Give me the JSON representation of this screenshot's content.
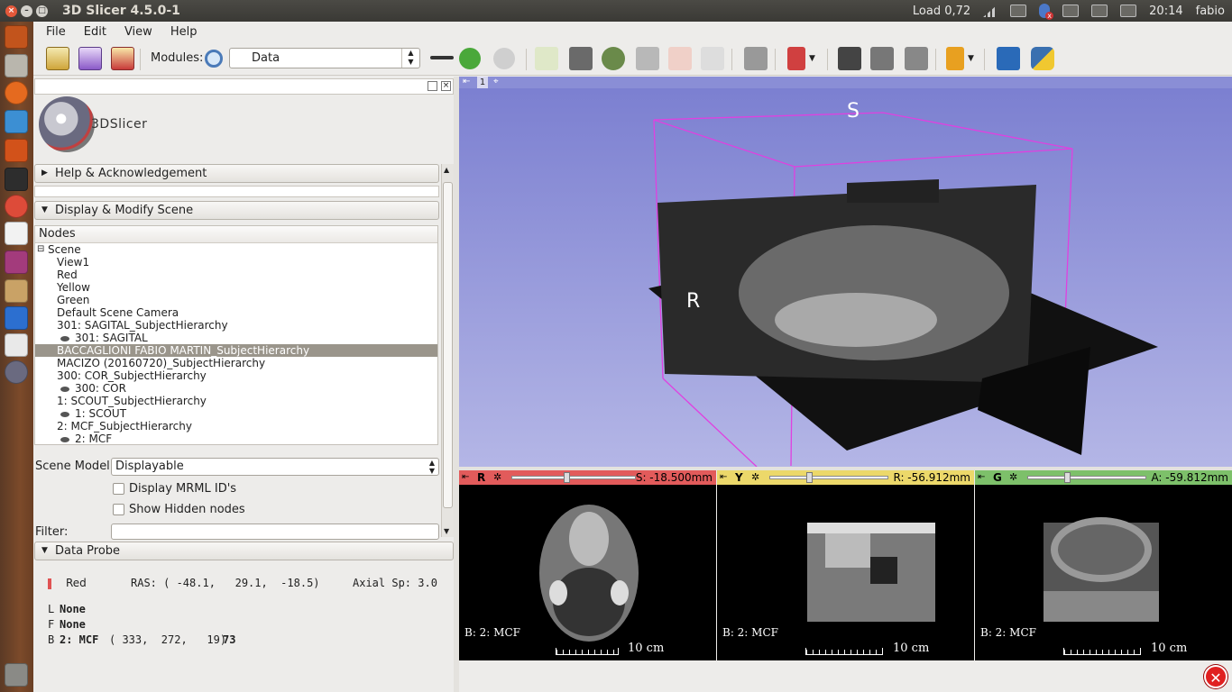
{
  "window": {
    "title": "3D Slicer 4.5.0-1"
  },
  "tray": {
    "load": "Load 0,72",
    "time": "20:14",
    "user": "fabio"
  },
  "menu": {
    "file": "File",
    "edit": "Edit",
    "view": "View",
    "help": "Help"
  },
  "toolbar": {
    "modules_label": "Modules:",
    "module_selected": "Data",
    "icons": [
      "data-icon",
      "dcm-icon",
      "save-icon",
      "search-icon",
      "layout-icon",
      "back-icon",
      "forward-icon"
    ]
  },
  "panel": {
    "logo_text": "3DSlicer",
    "help_section": "Help & Acknowledgement",
    "scene_section": "Display & Modify Scene",
    "nodes_header": "Nodes",
    "tree": [
      {
        "label": "Scene",
        "indent": 0,
        "eye": false
      },
      {
        "label": "View1",
        "indent": 1,
        "eye": false
      },
      {
        "label": "Red",
        "indent": 1,
        "eye": false
      },
      {
        "label": "Yellow",
        "indent": 1,
        "eye": false
      },
      {
        "label": "Green",
        "indent": 1,
        "eye": false
      },
      {
        "label": "Default Scene Camera",
        "indent": 1,
        "eye": false
      },
      {
        "label": "301: SAGITAL_SubjectHierarchy",
        "indent": 1,
        "eye": false
      },
      {
        "label": "301: SAGITAL",
        "indent": 2,
        "eye": true
      },
      {
        "label": "BACCAGLIONI FABIO MARTIN_SubjectHierarchy",
        "indent": 1,
        "eye": false,
        "selected": true
      },
      {
        "label": "MACIZO (20160720)_SubjectHierarchy",
        "indent": 1,
        "eye": false
      },
      {
        "label": "300: COR_SubjectHierarchy",
        "indent": 1,
        "eye": false
      },
      {
        "label": "300: COR",
        "indent": 2,
        "eye": true
      },
      {
        "label": "1: SCOUT_SubjectHierarchy",
        "indent": 1,
        "eye": false
      },
      {
        "label": "1: SCOUT",
        "indent": 2,
        "eye": true
      },
      {
        "label": "2: MCF_SubjectHierarchy",
        "indent": 1,
        "eye": false
      },
      {
        "label": "2: MCF",
        "indent": 2,
        "eye": true
      }
    ],
    "scene_model_label": "Scene Model:",
    "scene_model_value": "Displayable",
    "mrml_ids_label": "Display MRML ID's",
    "hidden_nodes_label": "Show Hidden nodes",
    "filter_label": "Filter:",
    "probe_section": "Data Probe",
    "probe": {
      "view": "Red",
      "ras": "RAS: ( -48.1,   29.1,  -18.5)",
      "spacing": "Axial Sp: 3.0",
      "l_prefix": "L",
      "l_value": "None",
      "f_prefix": "F",
      "f_value": "None",
      "b_prefix": "B",
      "b_name": "2: MCF",
      "b_ijk": "( 333,  272,   19)",
      "b_value": "73"
    }
  },
  "view3d": {
    "number": "1",
    "s_label": "S",
    "r_label": "R"
  },
  "slices": [
    {
      "name": "red",
      "letter": "R",
      "offset": "S: -18.500mm",
      "volume": "B: 2: MCF",
      "scale": "10 cm",
      "color": "#e25b5b",
      "slider_level": 0.44
    },
    {
      "name": "yellow",
      "letter": "Y",
      "offset": "R: -56.912mm",
      "volume": "B: 2: MCF",
      "scale": "10 cm",
      "color": "#ecd86a",
      "slider_level": 0.33
    },
    {
      "name": "green",
      "letter": "G",
      "offset": "A: -59.812mm",
      "volume": "B: 2: MCF",
      "scale": "10 cm",
      "color": "#7dc06a",
      "slider_level": 0.33
    }
  ]
}
